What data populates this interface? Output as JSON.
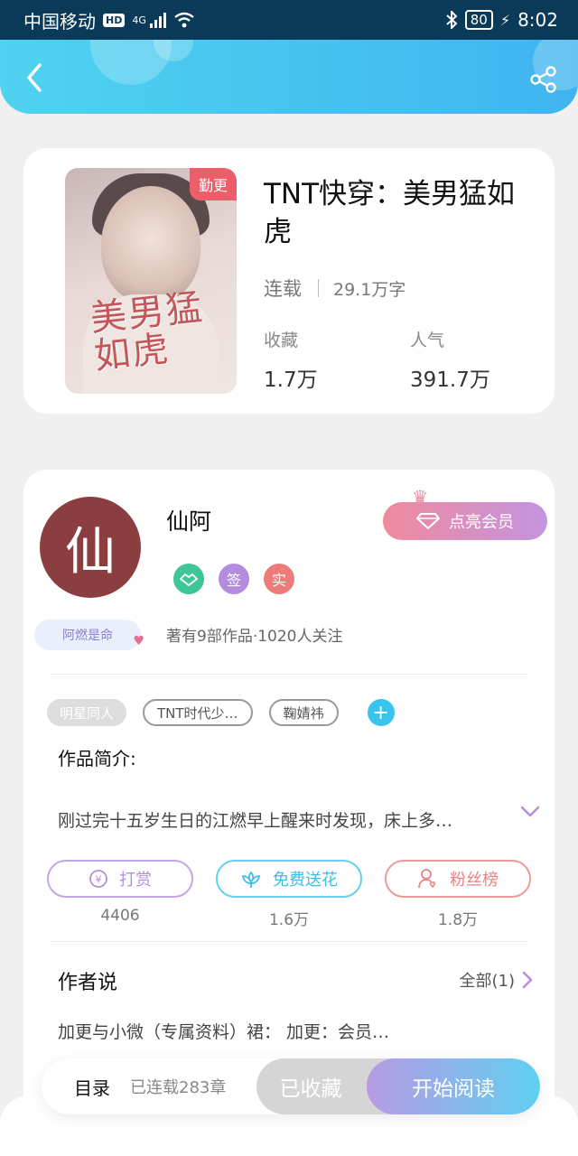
{
  "status_bar": {
    "carrier": "中国移动",
    "hd": "HD",
    "network": "4G",
    "battery": "80",
    "time": "8:02"
  },
  "book": {
    "title": "TNT快穿：美男猛如虎",
    "cover_title": "美男猛如虎",
    "cover_badge": "勤更",
    "status": "连载",
    "word_count": "29.1万字",
    "favorites_label": "收藏",
    "favorites_value": "1.7万",
    "popularity_label": "人气",
    "popularity_value": "391.7万"
  },
  "author": {
    "avatar_char": "仙",
    "name": "仙阿",
    "fan_tag": "阿燃是命",
    "badge_sign": "签",
    "badge_real": "实",
    "stats": "著有9部作品·1020人关注",
    "vip_button": "点亮会员"
  },
  "tags": [
    "明星同人",
    "TNT时代少…",
    "鞠婧祎"
  ],
  "intro": {
    "label": "作品简介:",
    "text": "刚过完十五岁生日的江燃早上醒来时发现，床上多…"
  },
  "actions": [
    {
      "label": "打赏",
      "count": "4406",
      "color": "#b690dc"
    },
    {
      "label": "免费送花",
      "count": "1.6万",
      "color": "#4cc8e8"
    },
    {
      "label": "粉丝榜",
      "count": "1.8万",
      "color": "#e98282"
    }
  ],
  "author_says": {
    "label": "作者说",
    "all_link": "全部(1)",
    "note": "加更与小微（专属资料）裙：  加更：会员…"
  },
  "bottom_bar": {
    "toc": "目录",
    "chapter_count": "已连载283章",
    "favorited": "已收藏",
    "start_reading": "开始阅读"
  },
  "colors": {
    "header_start": "#4fd3f0",
    "header_end": "#41b4f0",
    "accent_purple": "#b690dc",
    "accent_blue": "#4cc8e8"
  }
}
